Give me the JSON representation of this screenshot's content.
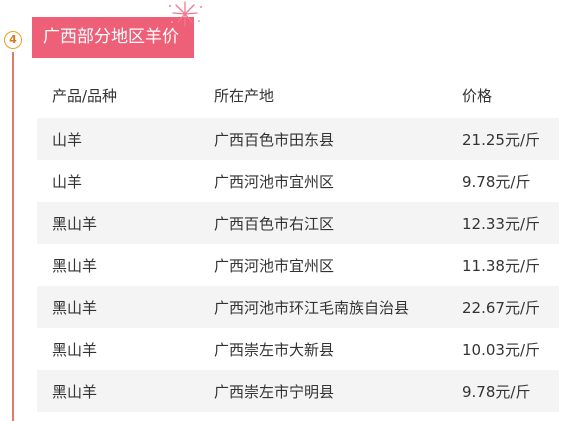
{
  "section": {
    "step_number": "4",
    "title": "广西部分地区羊价"
  },
  "colors": {
    "banner_bg": "#ee5f78",
    "timeline_line": "#e07a6a",
    "badge_border": "#f0a020",
    "row_stripe": "#f4f4f4"
  },
  "table": {
    "headers": {
      "product": "产品/品种",
      "origin": "所在产地",
      "price": "价格"
    },
    "rows": [
      {
        "product": "山羊",
        "origin": "广西百色市田东县",
        "price": "21.25元/斤"
      },
      {
        "product": "山羊",
        "origin": "广西河池市宜州区",
        "price": "9.78元/斤"
      },
      {
        "product": "黑山羊",
        "origin": "广西百色市右江区",
        "price": "12.33元/斤"
      },
      {
        "product": "黑山羊",
        "origin": "广西河池市宜州区",
        "price": "11.38元/斤"
      },
      {
        "product": "黑山羊",
        "origin": "广西河池市环江毛南族自治县",
        "price": "22.67元/斤"
      },
      {
        "product": "黑山羊",
        "origin": "广西崇左市大新县",
        "price": "10.03元/斤"
      },
      {
        "product": "黑山羊",
        "origin": "广西崇左市宁明县",
        "price": "9.78元/斤"
      }
    ]
  }
}
